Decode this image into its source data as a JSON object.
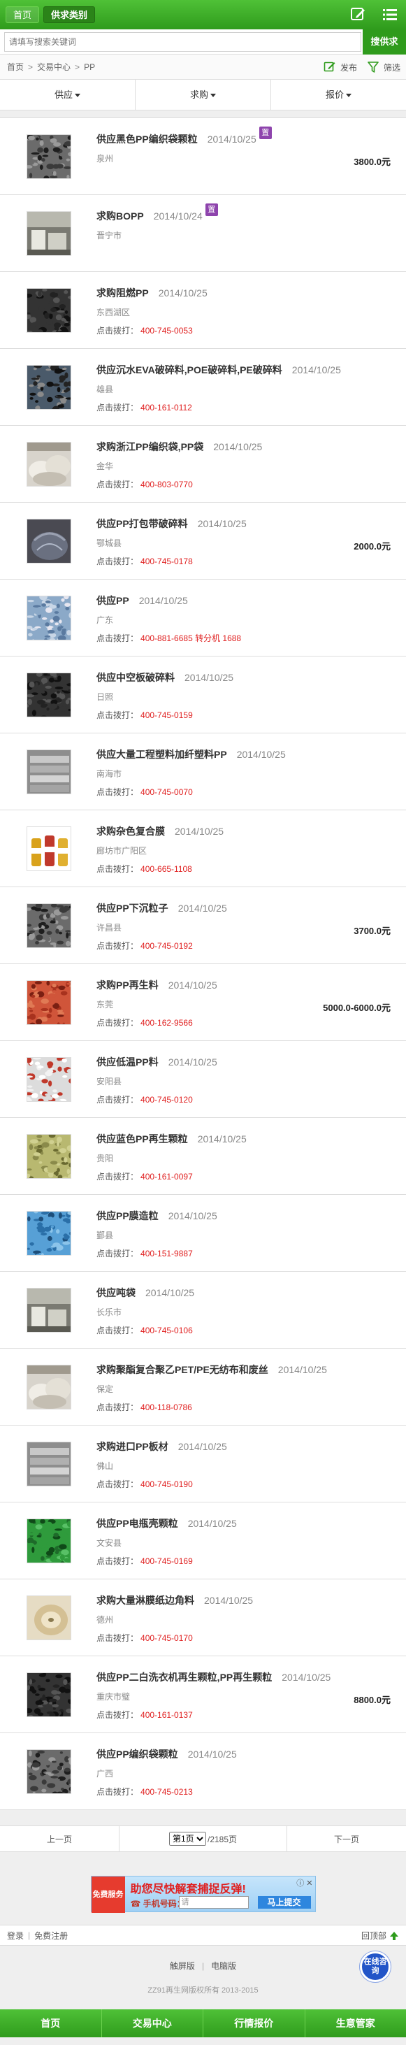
{
  "header": {
    "tabs": [
      {
        "label": "首页",
        "active": false
      },
      {
        "label": "供求类别",
        "active": true
      }
    ],
    "icons": [
      "edit-icon",
      "menu-icon"
    ]
  },
  "search": {
    "placeholder": "请填写搜索关键词",
    "button": "搜供求"
  },
  "breadcrumb": {
    "items": [
      "首页",
      "交易中心",
      "PP"
    ],
    "separator": ">",
    "publish": "发布",
    "filter": "筛选"
  },
  "filters": [
    "供应",
    "求购",
    "报价"
  ],
  "labels": {
    "tel_prefix": "点击拨打："
  },
  "listings": [
    {
      "title": "供应黑色PP编织袋颗粒",
      "date": "2014/10/25",
      "badge": "置",
      "location": "泉州",
      "tel": "",
      "price": "3800.0元",
      "img": "pellets-dark"
    },
    {
      "title": "求购BOPP",
      "date": "2014/10/24",
      "badge": "置",
      "location": "晋宁市",
      "tel": "",
      "price": "",
      "img": "warehouse"
    },
    {
      "title": "求购阻燃PP",
      "date": "2014/10/25",
      "badge": "",
      "location": "东西湖区",
      "tel": "400-745-0053",
      "price": "",
      "img": "pellets-black"
    },
    {
      "title": "供应沉水EVA破碎料,POE破碎料,PE破碎料",
      "date": "2014/10/25",
      "badge": "",
      "location": "雄县",
      "tel": "400-161-0112",
      "price": "",
      "img": "flakes-dark"
    },
    {
      "title": "求购浙江PP编织袋,PP袋",
      "date": "2014/10/25",
      "badge": "",
      "location": "金华",
      "tel": "400-803-0770",
      "price": "",
      "img": "bags-pile"
    },
    {
      "title": "供应PP打包带破碎料",
      "date": "2014/10/25",
      "badge": "",
      "location": "鄂城县",
      "tel": "400-745-0178",
      "price": "2000.0元",
      "img": "strap-pile"
    },
    {
      "title": "供应PP",
      "date": "2014/10/25",
      "badge": "",
      "location": "广东",
      "tel": "400-881-6685 转分机 1688",
      "price": "",
      "img": "mixed-plastic"
    },
    {
      "title": "供应中空板破碎料",
      "date": "2014/10/25",
      "badge": "",
      "location": "日照",
      "tel": "400-745-0159",
      "price": "",
      "img": "pellets-black"
    },
    {
      "title": "供应大量工程塑料加纤塑料PP",
      "date": "2014/10/25",
      "badge": "",
      "location": "南海市",
      "tel": "400-745-0070",
      "price": "",
      "img": "sheets-grey"
    },
    {
      "title": "求购杂色复合膜",
      "date": "2014/10/25",
      "badge": "",
      "location": "廊坊市广阳区",
      "tel": "400-665-1108",
      "price": "",
      "img": "bottles"
    },
    {
      "title": "供应PP下沉粒子",
      "date": "2014/10/25",
      "badge": "",
      "location": "许昌县",
      "tel": "400-745-0192",
      "price": "3700.0元",
      "img": "pellets-dark"
    },
    {
      "title": "求购PP再生料",
      "date": "2014/10/25",
      "badge": "",
      "location": "东莞",
      "tel": "400-162-9566",
      "price": "5000.0-6000.0元",
      "img": "pellets-red"
    },
    {
      "title": "供应低温PP料",
      "date": "2014/10/25",
      "badge": "",
      "location": "安阳县",
      "tel": "400-745-0120",
      "price": "",
      "img": "white-powder"
    },
    {
      "title": "供应蓝色PP再生颗粒",
      "date": "2014/10/25",
      "badge": "",
      "location": "贵阳",
      "tel": "400-161-0097",
      "price": "",
      "img": "bag-olive"
    },
    {
      "title": "供应PP膜造粒",
      "date": "2014/10/25",
      "badge": "",
      "location": "鄞县",
      "tel": "400-151-9887",
      "price": "",
      "img": "pellets-blue"
    },
    {
      "title": "供应吨袋",
      "date": "2014/10/25",
      "badge": "",
      "location": "长乐市",
      "tel": "400-745-0106",
      "price": "",
      "img": "warehouse"
    },
    {
      "title": "求购聚酯复合聚乙PET/PE无纺布和废丝",
      "date": "2014/10/25",
      "badge": "",
      "location": "保定",
      "tel": "400-118-0786",
      "price": "",
      "img": "bags-pile"
    },
    {
      "title": "求购进口PP板材",
      "date": "2014/10/25",
      "badge": "",
      "location": "佛山",
      "tel": "400-745-0190",
      "price": "",
      "img": "sheets-grey"
    },
    {
      "title": "供应PP电瓶壳颗粒",
      "date": "2014/10/25",
      "badge": "",
      "location": "文安县",
      "tel": "400-745-0169",
      "price": "",
      "img": "pellets-green"
    },
    {
      "title": "求购大量淋膜纸边角料",
      "date": "2014/10/25",
      "badge": "",
      "location": "德州",
      "tel": "400-745-0170",
      "price": "",
      "img": "paper-roll"
    },
    {
      "title": "供应PP二白洗衣机再生颗粒,PP再生颗粒",
      "date": "2014/10/25",
      "badge": "",
      "location": "重庆市璧",
      "tel": "400-161-0137",
      "price": "8800.0元",
      "img": "pellets-black"
    },
    {
      "title": "供应PP编织袋颗粒",
      "date": "2014/10/25",
      "badge": "",
      "location": "广西",
      "tel": "400-745-0213",
      "price": "",
      "img": "pellets-dark"
    }
  ],
  "pager": {
    "prev": "上一页",
    "current": "第1页",
    "total": "/2185页",
    "next": "下一页"
  },
  "ad": {
    "tag": "免费服务",
    "headline": "助您尽快解套捕捉反弹!",
    "phone_label": "手机号码：",
    "input_value": "请",
    "submit": "马上提交",
    "close": "ⓘ ✕"
  },
  "loginbar": {
    "login": "登录",
    "register": "免费注册",
    "back_to_top": "回顶部"
  },
  "footer": {
    "touch": "触屏版",
    "pc": "电脑版",
    "copyright": "ZZ91再生网版权所有 2013-2015"
  },
  "online": {
    "label": "在线咨询"
  },
  "bottom_nav": [
    "首页",
    "交易中心",
    "行情报价",
    "生意管家"
  ],
  "colors": {
    "brand_green": "#2f9b1c",
    "price_red": "#e02020",
    "badge_purple": "#8e44ad"
  }
}
